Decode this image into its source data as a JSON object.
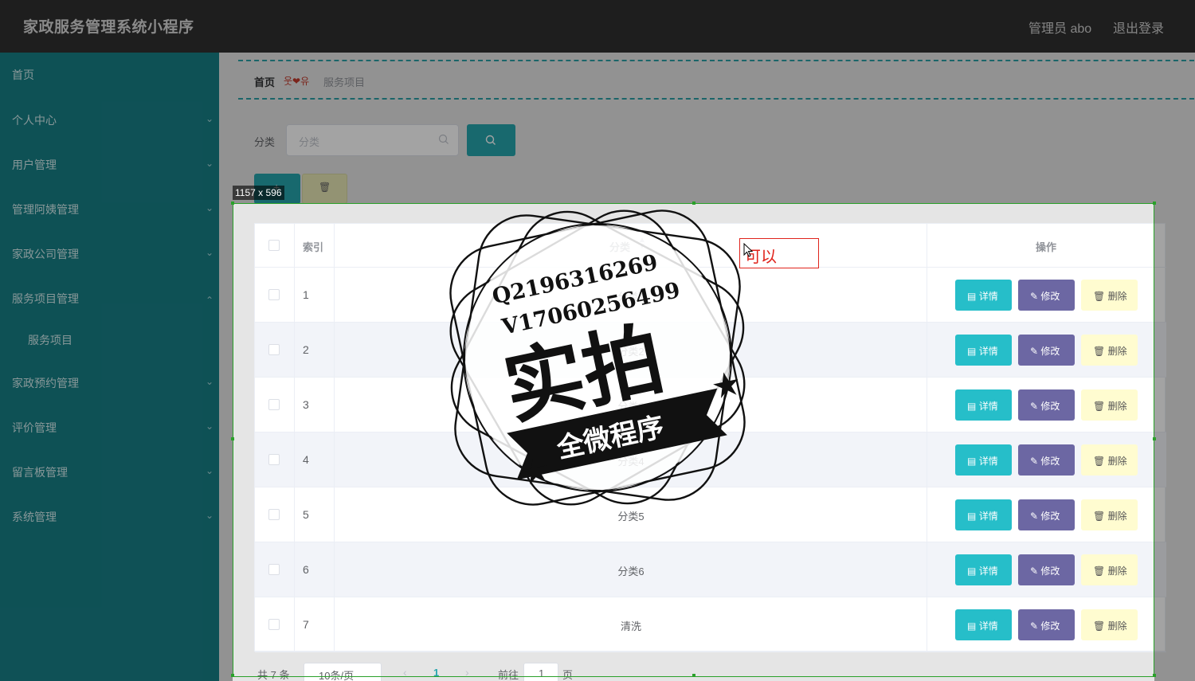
{
  "header": {
    "title": "家政服务管理系统小程序",
    "admin": "管理员 abo",
    "logout": "退出登录"
  },
  "sidebar": {
    "items": [
      {
        "label": "首页"
      },
      {
        "label": "个人中心"
      },
      {
        "label": "用户管理"
      },
      {
        "label": "管理阿姨管理"
      },
      {
        "label": "家政公司管理"
      },
      {
        "label": "服务项目管理"
      },
      {
        "label": "服务项目"
      },
      {
        "label": "家政预约管理"
      },
      {
        "label": "评价管理"
      },
      {
        "label": "留言板管理"
      },
      {
        "label": "系统管理"
      }
    ]
  },
  "breadcrumb": {
    "home": "首页",
    "separator": "웃❤유",
    "current": "服务项目"
  },
  "search": {
    "label": "分类",
    "placeholder": "分类"
  },
  "table": {
    "headers": {
      "index": "索引",
      "category": "分类",
      "ops": "操作"
    },
    "rows": [
      {
        "index": "1",
        "category": "分类1"
      },
      {
        "index": "2",
        "category": "分类2"
      },
      {
        "index": "3",
        "category": "分类3"
      },
      {
        "index": "4",
        "category": "分类4"
      },
      {
        "index": "5",
        "category": "分类5"
      },
      {
        "index": "6",
        "category": "分类6"
      },
      {
        "index": "7",
        "category": "清洗"
      }
    ],
    "ops": {
      "detail": "详情",
      "edit": "修改",
      "delete": "删除"
    }
  },
  "pager": {
    "total": "共 7 条",
    "page_size": "10条/页",
    "current_page": "1",
    "goto": "前往",
    "goto_value": "1",
    "page_unit": "页"
  },
  "overlay": {
    "size_label": "1157 x 596",
    "annotation": "可以"
  },
  "watermark": {
    "line1": "Q2196316269",
    "line2": "V17060256499",
    "main": "实拍",
    "banner": "全微程序"
  },
  "colors": {
    "primary": "#26a5ad",
    "sidebar": "#177f86",
    "edit": "#6c67a3",
    "delete": "#fffcd0",
    "detail": "#26bec9"
  }
}
